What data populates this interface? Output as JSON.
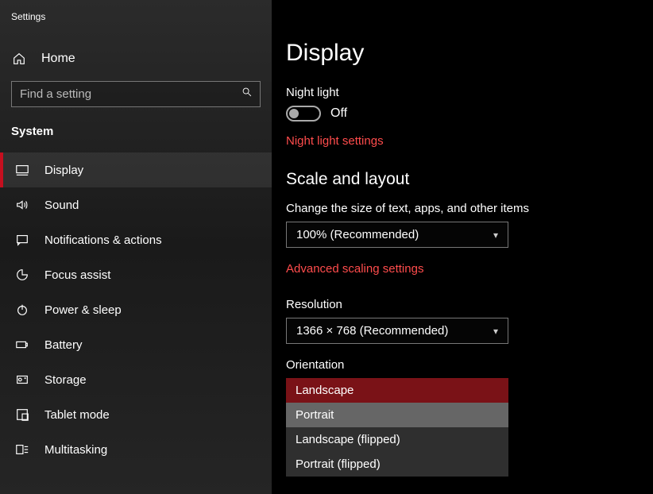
{
  "appTitle": "Settings",
  "home": "Home",
  "search": {
    "placeholder": "Find a setting"
  },
  "category": "System",
  "nav": [
    {
      "label": "Display"
    },
    {
      "label": "Sound"
    },
    {
      "label": "Notifications & actions"
    },
    {
      "label": "Focus assist"
    },
    {
      "label": "Power & sleep"
    },
    {
      "label": "Battery"
    },
    {
      "label": "Storage"
    },
    {
      "label": "Tablet mode"
    },
    {
      "label": "Multitasking"
    }
  ],
  "page": {
    "title": "Display",
    "nightLight": {
      "label": "Night light",
      "state": "Off",
      "link": "Night light settings"
    },
    "scale": {
      "heading": "Scale and layout",
      "sizeLabel": "Change the size of text, apps, and other items",
      "sizeValue": "100% (Recommended)",
      "advanced": "Advanced scaling settings",
      "resolutionLabel": "Resolution",
      "resolutionValue": "1366 × 768 (Recommended)",
      "orientationLabel": "Orientation",
      "orientationOptions": [
        "Landscape",
        "Portrait",
        "Landscape (flipped)",
        "Portrait (flipped)"
      ]
    }
  }
}
